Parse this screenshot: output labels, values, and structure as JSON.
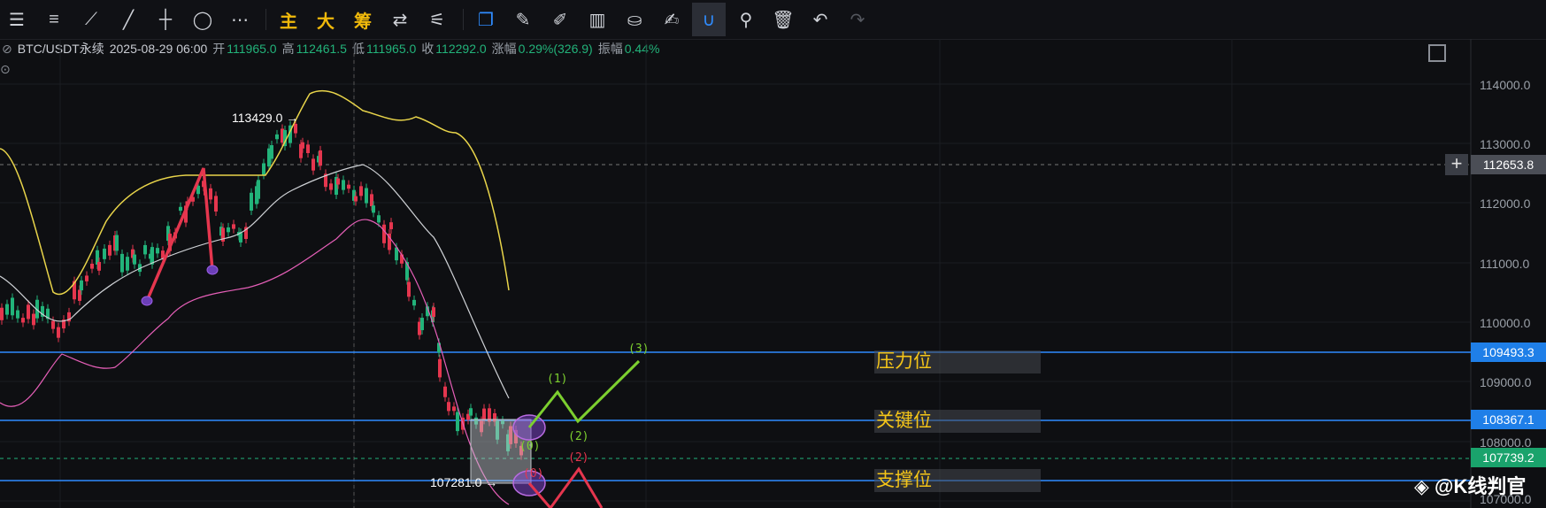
{
  "toolbar": {
    "items": [
      {
        "name": "menu-icon",
        "glyph": "☰"
      },
      {
        "name": "lines-icon",
        "glyph": "≡"
      },
      {
        "name": "trend-line-icon",
        "glyph": "⟋"
      },
      {
        "name": "ray-icon",
        "glyph": "╱"
      },
      {
        "name": "horizontal-line-icon",
        "glyph": "┼"
      },
      {
        "name": "ellipse-icon",
        "glyph": "◯"
      },
      {
        "name": "more-icon",
        "glyph": "⋯"
      }
    ],
    "indicator_buttons": [
      "主",
      "大",
      "筹"
    ],
    "tools": [
      {
        "name": "compare-icon",
        "glyph": "⇄"
      },
      {
        "name": "measure-icon",
        "glyph": "⚟"
      }
    ],
    "right_tools": [
      {
        "name": "copy-icon",
        "glyph": "❐",
        "state": "blue"
      },
      {
        "name": "ruler-icon",
        "glyph": "✎"
      },
      {
        "name": "brush-icon",
        "glyph": "✐"
      },
      {
        "name": "candles-icon",
        "glyph": "▥"
      },
      {
        "name": "lock-icon",
        "glyph": "⛀"
      },
      {
        "name": "edit-icon",
        "glyph": "✍"
      },
      {
        "name": "magnet-icon",
        "glyph": "∪",
        "state": "active"
      },
      {
        "name": "filter-icon",
        "glyph": "⚲"
      },
      {
        "name": "trash-icon",
        "glyph": "🗑"
      },
      {
        "name": "undo-icon",
        "glyph": "↶"
      },
      {
        "name": "redo-icon",
        "glyph": "↷",
        "state": "dim"
      }
    ]
  },
  "info": {
    "symbol": "BTC/USDT永续",
    "datetime": "2025-08-29 06:00",
    "open_label": "开",
    "open": "111965.0",
    "high_label": "高",
    "high": "112461.5",
    "low_label": "低",
    "low": "111965.0",
    "close_label": "收",
    "close": "112292.0",
    "change_label": "涨幅",
    "change": "0.29%(326.9)",
    "amplitude_label": "振幅",
    "amplitude": "0.44%"
  },
  "annotations": {
    "high_marker": "113429.0 →",
    "low_marker": "107281.0 →",
    "wave_labels": [
      "(1)",
      "(2)",
      "(3)",
      "(0)",
      "(2)",
      "(0)"
    ]
  },
  "levels": [
    {
      "label": "压力位",
      "price": "109493.3"
    },
    {
      "label": "关键位",
      "price": "108367.1"
    },
    {
      "label": "支撑位",
      "price": ""
    }
  ],
  "price_tags": {
    "current": "112653.8",
    "green": "107739.2"
  },
  "axis": [
    "114000.0",
    "113000.0",
    "112000.0",
    "111000.0",
    "110000.0",
    "109000.0",
    "108000.0",
    "107000.0"
  ],
  "watermark": "◈ @K线判官",
  "colors": {
    "up": "#22b37a",
    "down": "#e5364e",
    "upper_band": "#e8d44a",
    "mid_band": "#cfd2d6",
    "lower_band": "#e65fb8",
    "level_line": "#2f8cff",
    "label_yellow": "#f5c518"
  }
}
